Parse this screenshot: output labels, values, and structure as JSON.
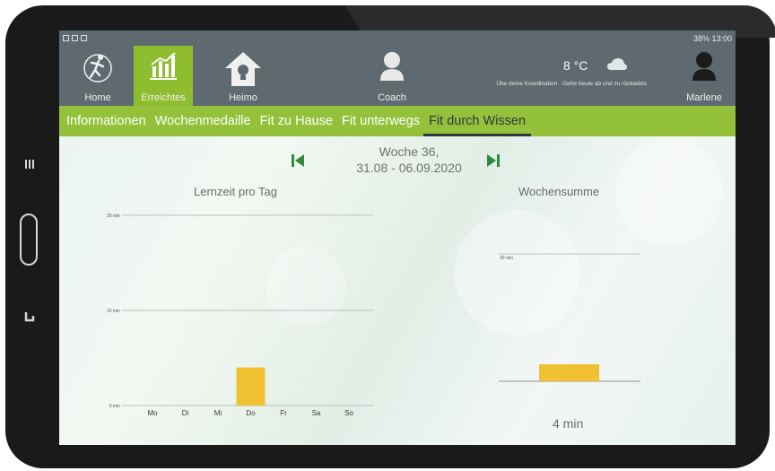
{
  "statusbar": {
    "right_text": "38% 13:00"
  },
  "nav": {
    "home": "Home",
    "erreichtes": "Erreichtes",
    "heimo": "Heimo",
    "coach": "Coach",
    "user": "Marlene"
  },
  "weather": {
    "temp": "8 °C",
    "tip": "Übe deine Koordination - Gehe heute ab und zu rückwärts"
  },
  "tabs": [
    "Informationen",
    "Wochenmedaille",
    "Fit zu Hause",
    "Fit unterwegs",
    "Fit durch Wissen"
  ],
  "active_tab": "Fit durch Wissen",
  "week": {
    "line1": "Woche 36,",
    "line2": "31.08 - 06.09.2020"
  },
  "colors": {
    "accent_green": "#93c13a",
    "appbar": "#5e6a6f",
    "bar_yellow": "#f0c232",
    "nav_arrow": "#2e8b3d"
  },
  "chart_data": [
    {
      "type": "bar",
      "title": "Lernzeit pro Tag",
      "categories": [
        "Mo",
        "Di",
        "Mi",
        "Do",
        "Fr",
        "Sa",
        "So"
      ],
      "values": [
        0,
        0,
        0,
        4,
        0,
        0,
        0
      ],
      "ytick_labels": [
        "0 min",
        "10 min",
        "20 min"
      ],
      "yticks": [
        0,
        10,
        20
      ],
      "ylim": [
        0,
        20
      ],
      "grid": true
    },
    {
      "type": "bar",
      "title": "Wochensumme",
      "categories": [
        ""
      ],
      "values": [
        4
      ],
      "ytick_labels": [
        "30 min"
      ],
      "yticks": [
        30
      ],
      "ylim": [
        0,
        30
      ],
      "grid": true,
      "total_label": "4 min"
    }
  ]
}
